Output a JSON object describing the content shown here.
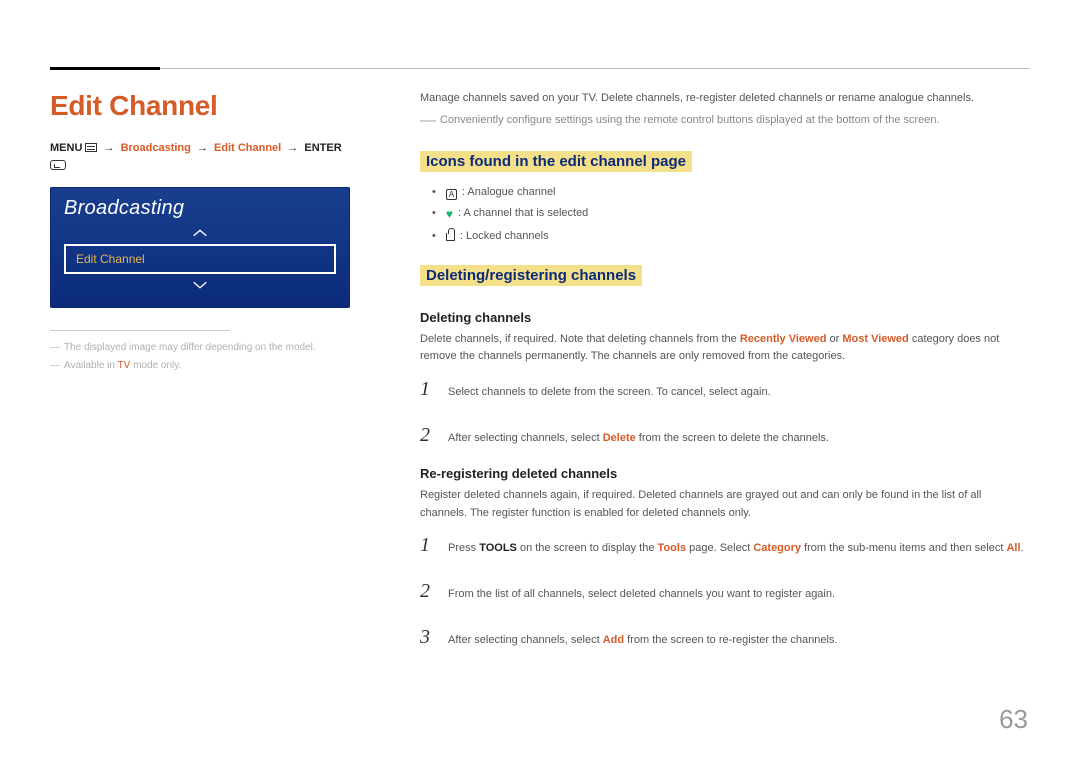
{
  "page_number": "63",
  "left": {
    "title": "Edit Channel",
    "breadcrumb": {
      "menu": "MENU",
      "p1": "Broadcasting",
      "p2": "Edit Channel",
      "enter": "ENTER"
    },
    "tv": {
      "title": "Broadcasting",
      "item": "Edit Channel"
    },
    "notes": {
      "n1a": "The displayed image may differ depending on the model.",
      "n2a": "Available in ",
      "n2b": "TV",
      "n2c": " mode only."
    }
  },
  "right": {
    "intro": "Manage channels saved on your TV. Delete channels, re-register deleted channels or rename analogue channels.",
    "intro2": "Conveniently configure settings using the remote control buttons displayed at the bottom of the screen.",
    "sec1_title": "Icons found in the edit channel page",
    "icons": {
      "a": ": Analogue channel",
      "heart": ": A channel that is selected",
      "lock": ": Locked channels"
    },
    "sec2_title": "Deleting/registering channels",
    "del_h": "Deleting channels",
    "del_p_a": "Delete channels, if required. Note that deleting channels from the ",
    "del_p_b": "Recently Viewed",
    "del_p_c": " or ",
    "del_p_d": "Most Viewed",
    "del_p_e": " category does not remove the channels permanently. The channels are only removed from the categories.",
    "del_steps": {
      "s1": "Select channels to delete from the screen. To cancel, select again.",
      "s2a": "After selecting channels, select ",
      "s2b": "Delete",
      "s2c": " from the screen to delete the channels."
    },
    "rereg_h": "Re-registering deleted channels",
    "rereg_p": "Register deleted channels again, if required. Deleted channels are grayed out and can only be found in the list of all channels. The register function is enabled for deleted channels only.",
    "rereg_steps": {
      "s1a": "Press ",
      "s1b": "TOOLS",
      "s1c": " on the screen to display the ",
      "s1d": "Tools",
      "s1e": " page. Select ",
      "s1f": "Category",
      "s1g": " from the sub-menu items and then select ",
      "s1h": "All",
      "s1i": ".",
      "s2": "From the list of all channels, select deleted channels you want to register again.",
      "s3a": "After selecting channels, select ",
      "s3b": "Add",
      "s3c": " from the screen to re-register the channels."
    }
  }
}
